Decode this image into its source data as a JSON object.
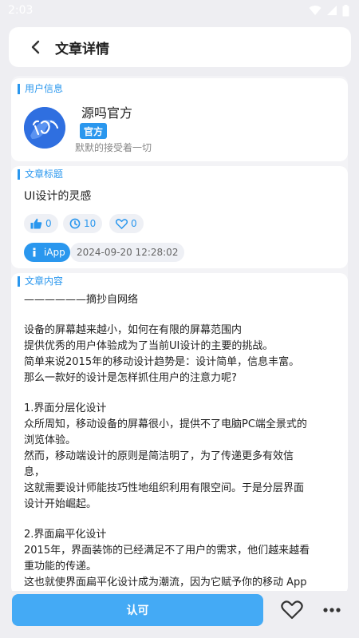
{
  "status": {
    "time": "2:03"
  },
  "header": {
    "title": "文章详情"
  },
  "user_section": {
    "label": "用户信息",
    "name": "源吗官方",
    "badge": "官方",
    "bio": "默默的接受着一切"
  },
  "article_section": {
    "label": "文章标题",
    "title": "UI设计的灵感",
    "likes": "0",
    "views": "10",
    "favorites": "0",
    "app_tag": "iApp",
    "timestamp": "2024-09-20 12:28:02"
  },
  "content_section": {
    "label": "文章内容",
    "paragraphs": [
      "——————摘抄自网络",
      "设备的屏幕越来越小，如何在有限的屏幕范围内\n提供优秀的用户体验成为了当前UI设计的主要的挑战。\n简单来说2015年的移动设计趋势是：设计简单，信息丰富。\n那么一款好的设计是怎样抓住用户的注意力呢?",
      "1.界面分层化设计\n众所周知，移动设备的屏幕很小，提供不了电脑PC端全景式的\n浏览体验。\n然而，移动端设计的原则是简洁明了，为了传递更多有效信\n息，\n这就需要设计师能技巧性地组织利用有限空间。于是分层界面\n设计开始崛起。",
      "2.界面扁平化设计\n2015年，界面装饰的已经满足不了用户的需求，他们越来越看\n重功能的传递。\n这也就使界面扁平化设计成为潮流，因为它赋予你的移动 App"
    ]
  },
  "bottom": {
    "approve_label": "认可"
  },
  "colors": {
    "accent": "#2a97ee",
    "button": "#44aaf5"
  }
}
